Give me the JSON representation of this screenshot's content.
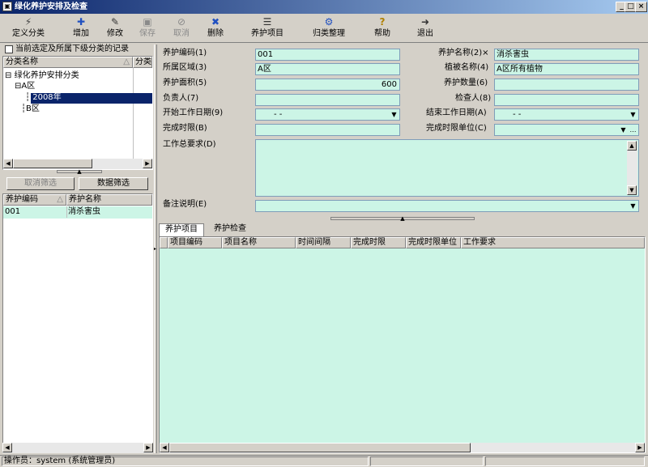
{
  "window": {
    "title": "绿化养护安排及检查"
  },
  "toolbar": {
    "items": [
      {
        "label": "定义分类",
        "icon": "⚡",
        "enabled": true
      },
      {
        "label": "增加",
        "icon": "✚",
        "enabled": true
      },
      {
        "label": "修改",
        "icon": "✎",
        "enabled": true
      },
      {
        "label": "保存",
        "icon": "▣",
        "enabled": false
      },
      {
        "label": "取消",
        "icon": "⊘",
        "enabled": false
      },
      {
        "label": "删除",
        "icon": "✖",
        "enabled": true
      },
      {
        "label": "养护项目",
        "icon": "☰",
        "enabled": true
      },
      {
        "label": "归类整理",
        "icon": "⚙",
        "enabled": true
      },
      {
        "label": "帮助",
        "icon": "?",
        "enabled": true
      },
      {
        "label": "退出",
        "icon": "➜",
        "enabled": true
      }
    ]
  },
  "left": {
    "checkbox_label": "当前选定及所属下级分类的记录",
    "tree_header": {
      "col1": "分类名称",
      "col2": "分类"
    },
    "tree": [
      "绿化养护安排分类",
      "A区",
      "2008年",
      "B区"
    ],
    "cancel_filter": "取消筛选",
    "data_filter": "数据筛选",
    "list_header": {
      "col1": "养护编码",
      "col2": "养护名称"
    },
    "rows": [
      {
        "code": "001",
        "name": "消杀害虫"
      }
    ]
  },
  "form": {
    "care_code_label": "养护编码(1)",
    "care_code": "001",
    "care_name_label": "养护名称(2)×",
    "care_name": "消杀害虫",
    "area_label": "所属区域(3)",
    "area": "A区",
    "plant_label": "植被名称(4)",
    "plant": "A区所有植物",
    "care_area_label": "养护面积(5)",
    "care_area": "600",
    "care_qty_label": "养护数量(6)",
    "care_qty": "",
    "owner_label": "负责人(7)",
    "owner": "",
    "checker_label": "检查人(8)",
    "checker": "",
    "start_date_label": "开始工作日期(9)",
    "start_date": "-  -",
    "end_date_label": "结束工作日期(A)",
    "end_date": "-  -",
    "deadline_label": "完成时限(B)",
    "deadline": "",
    "deadline_unit_label": "完成时限单位(C)",
    "deadline_unit": "",
    "req_label": "工作总要求(D)",
    "req": "",
    "remark_label": "备注说明(E)",
    "remark": ""
  },
  "tabs": [
    {
      "label": "养护项目",
      "active": true
    },
    {
      "label": "养护检查",
      "active": false
    }
  ],
  "grid_headers": [
    "项目编码",
    "项目名称",
    "时间间隔",
    "完成时限",
    "完成时限单位",
    "工作要求"
  ],
  "status": {
    "operator": "操作员：system (系统管理员)"
  }
}
